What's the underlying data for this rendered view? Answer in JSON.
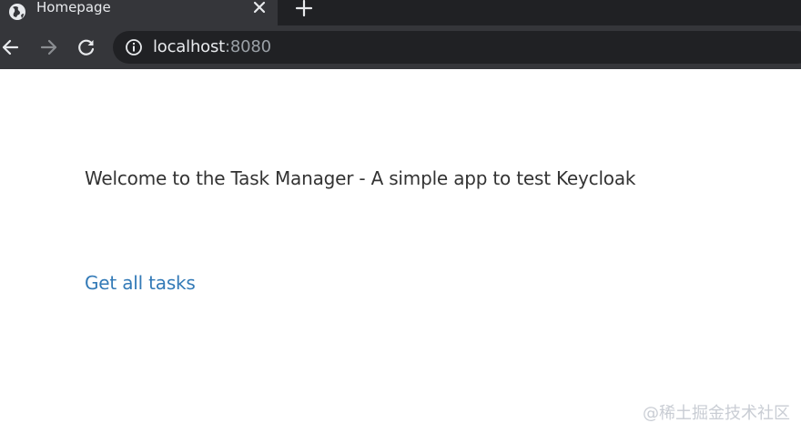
{
  "browser": {
    "tab_title": "Homepage",
    "url_host": "localhost",
    "url_port": ":8080"
  },
  "page": {
    "welcome_text": "Welcome to the Task Manager - A simple app to test Keycloak",
    "tasks_link": "Get all tasks"
  },
  "watermark": "@稀土掘金技术社区",
  "colors": {
    "chrome_bg": "#202124",
    "toolbar_bg": "#35363a",
    "link": "#337ab7",
    "text": "#333333"
  },
  "icons": {
    "favicon": "globe-icon",
    "close": "close-icon",
    "new_tab": "plus-icon",
    "back": "back-arrow-icon",
    "forward": "forward-arrow-icon",
    "reload": "reload-icon",
    "site_info": "info-icon"
  }
}
